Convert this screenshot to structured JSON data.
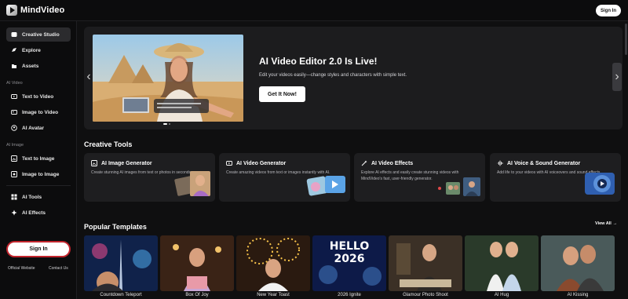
{
  "header": {
    "brand": "MindVideo",
    "signin_label": "Sign In"
  },
  "sidebar": {
    "top_items": [
      {
        "label": "Creative Studio",
        "icon": "studio-icon",
        "active": true
      },
      {
        "label": "Explore",
        "icon": "explore-icon"
      },
      {
        "label": "Assets",
        "icon": "assets-icon"
      }
    ],
    "sections": [
      {
        "title": "AI Video",
        "items": [
          {
            "label": "Text to Video",
            "icon": "text-video-icon"
          },
          {
            "label": "Image to Video",
            "icon": "image-video-icon"
          },
          {
            "label": "AI Avatar",
            "icon": "avatar-icon"
          }
        ]
      },
      {
        "title": "AI Image",
        "items": [
          {
            "label": "Text to Image",
            "icon": "text-image-icon"
          },
          {
            "label": "Image to Image",
            "icon": "image-image-icon"
          }
        ]
      }
    ],
    "extra_items": [
      {
        "label": "AI Tools",
        "icon": "tools-icon"
      },
      {
        "label": "AI Effects",
        "icon": "effects-icon"
      }
    ],
    "signin_label": "Sign In",
    "footer": {
      "official": "Official Website",
      "contact": "Contact Us"
    }
  },
  "banner": {
    "title": "AI Video Editor 2.0 Is Live!",
    "subtitle": "Edit your videos easily—change styles and characters with simple text.",
    "cta": "Get It Now!",
    "slides_total": 2,
    "slide_active": 1
  },
  "creative_tools": {
    "title": "Creative Tools",
    "cards": [
      {
        "title": "AI Image Generator",
        "desc": "Create stunning AI images from text or photos in seconds.",
        "icon": "image-gen-icon"
      },
      {
        "title": "AI Video Generator",
        "desc": "Create amazing videos from text or images instantly with AI.",
        "icon": "video-gen-icon"
      },
      {
        "title": "AI Video Effects",
        "desc": "Explore AI effects and easily create stunning videos with MindVideo's fast, user-friendly generator.",
        "icon": "wand-icon"
      },
      {
        "title": "AI Voice & Sound Generator",
        "desc": "Add life to your videos with AI voiceovers and sound effects.",
        "icon": "voice-icon"
      }
    ]
  },
  "templates": {
    "title": "Popular Templates",
    "view_all": "View All",
    "items": [
      {
        "label": "Countdown Teleport"
      },
      {
        "label": "Box Of Joy"
      },
      {
        "label": "New Year Toast"
      },
      {
        "label": "2026 Ignite"
      },
      {
        "label": "Glamour Photo Shoot"
      },
      {
        "label": "AI Hug"
      },
      {
        "label": "AI Kissing"
      }
    ],
    "ignite_text": "HELLO 2026"
  }
}
